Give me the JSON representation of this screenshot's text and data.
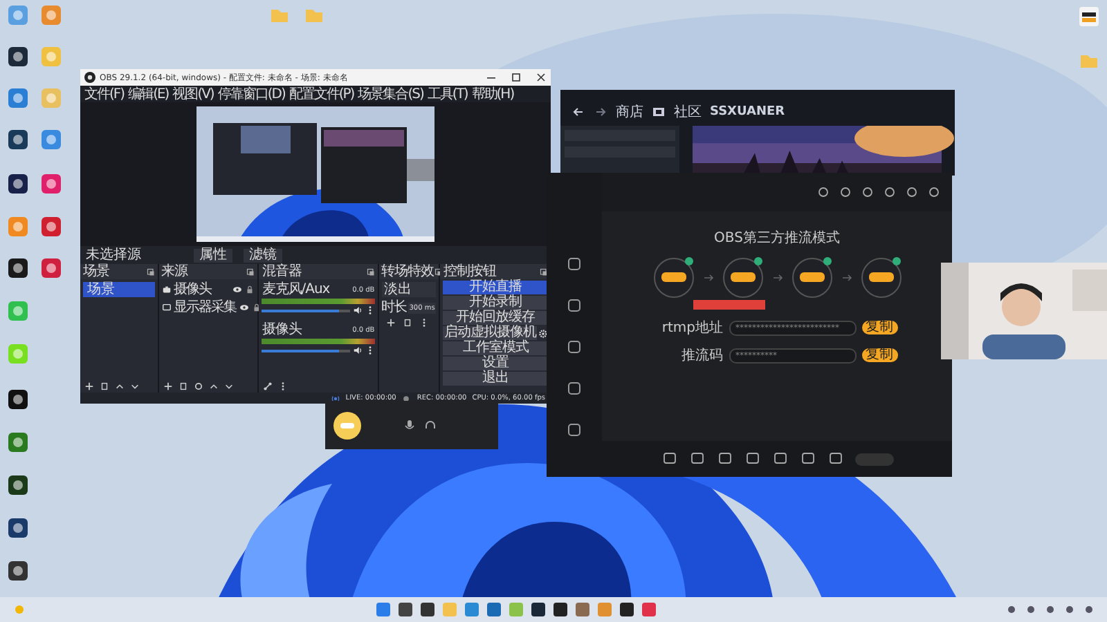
{
  "obs": {
    "title": "OBS 29.1.2 (64-bit, windows) - 配置文件: 未命名 - 场景: 未命名",
    "menu": [
      "文件(F)",
      "编辑(E)",
      "视图(V)",
      "停靠窗口(D)",
      "配置文件(P)",
      "场景集合(S)",
      "工具(T)",
      "帮助(H)"
    ],
    "source_label": "未选择源",
    "source_buttons": [
      "属性",
      "滤镜"
    ],
    "scenes": {
      "title": "场景",
      "items": [
        {
          "label": "场景",
          "selected": true
        }
      ]
    },
    "sources": {
      "title": "来源",
      "items": [
        {
          "label": "摄像头"
        },
        {
          "label": "显示器采集"
        }
      ]
    },
    "mixer": {
      "title": "混音器",
      "channels": [
        {
          "name": "麦克风/Aux",
          "reading": "0.0 dB",
          "level": 0.88
        },
        {
          "name": "摄像头",
          "reading": "0.0 dB",
          "level": 0.88
        }
      ]
    },
    "transitions": {
      "title": "转场特效",
      "type": "淡出",
      "duration_label": "时长",
      "duration": "300 ms"
    },
    "controls": {
      "title": "控制按钮",
      "buttons": [
        {
          "label": "开始直播",
          "selected": true
        },
        {
          "label": "开始录制",
          "selected": false
        },
        {
          "label": "开始回放缓存",
          "selected": false
        },
        {
          "label": "启动虚拟摄像机",
          "selected": false
        },
        {
          "label": "工作室模式",
          "selected": false
        },
        {
          "label": "设置",
          "selected": false
        },
        {
          "label": "退出",
          "selected": false
        }
      ]
    },
    "status_bar": {
      "live": "LIVE: 00:00:00",
      "rec": "REC: 00:00:00",
      "cpu": "CPU: 0.0%, 60.00 fps"
    }
  },
  "steam": {
    "nav": [
      "商店",
      "社区"
    ],
    "user": "SSXUANER"
  },
  "live_app": {
    "mode_title": "OBS第三方推流模式",
    "fields": [
      {
        "label": "rtmp地址",
        "value": "*************************",
        "action": "复制"
      },
      {
        "label": "推流码",
        "value": "**********",
        "action": "复制"
      }
    ]
  }
}
